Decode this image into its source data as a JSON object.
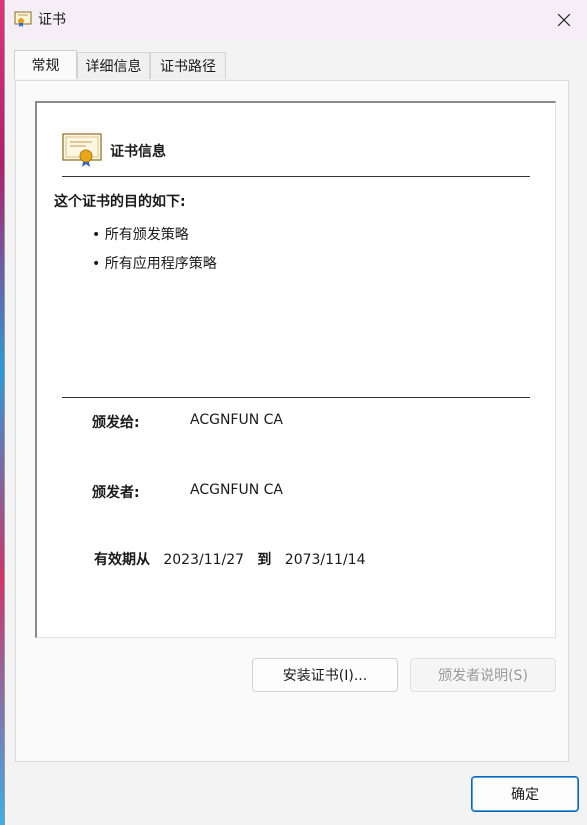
{
  "window": {
    "title": "证书"
  },
  "tabs": [
    {
      "label": "常规",
      "active": true
    },
    {
      "label": "详细信息",
      "active": false
    },
    {
      "label": "证书路径",
      "active": false
    }
  ],
  "info": {
    "title": "证书信息",
    "purpose_heading": "这个证书的目的如下:",
    "purposes": [
      "• 所有颁发策略",
      "• 所有应用程序策略"
    ],
    "issued_to_label": "颁发给:",
    "issued_to_value": "ACGNFUN CA",
    "issued_by_label": "颁发者:",
    "issued_by_value": "ACGNFUN CA",
    "valid_from_label": "有效期从",
    "valid_from": "2023/11/27",
    "valid_to_label": "到",
    "valid_to": "2073/11/14"
  },
  "buttons": {
    "install": "安装证书(I)...",
    "issuer_statement": "颁发者说明(S)",
    "ok": "确定"
  },
  "colors": {
    "accent": "#0067c0",
    "titlebar": "#f6eef6"
  }
}
